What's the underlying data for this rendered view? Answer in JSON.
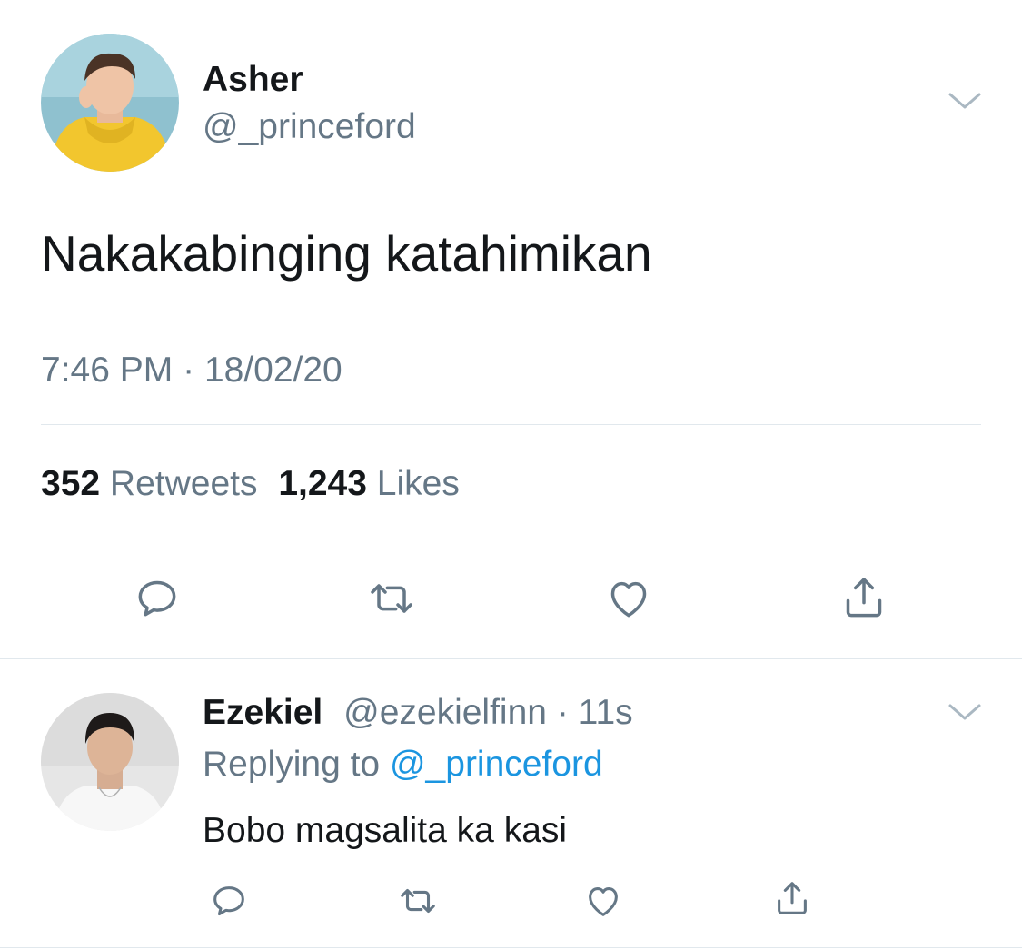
{
  "main_tweet": {
    "author_name": "Asher",
    "author_handle": "@_princeford",
    "text": "Nakakabinging katahimikan",
    "time": "7:46 PM",
    "separator": "·",
    "date": "18/02/20",
    "retweets_count": "352",
    "retweets_label": "Retweets",
    "likes_count": "1,243",
    "likes_label": "Likes",
    "actions": [
      "reply-icon",
      "retweet-icon",
      "like-icon",
      "share-icon"
    ]
  },
  "reply": {
    "author_name": "Ezekiel",
    "author_handle": "@ezekielfinn",
    "separator": "·",
    "age": "11s",
    "replying_label": "Replying to",
    "replying_handle": "@_princeford",
    "text": "Bobo magsalita ka kasi",
    "actions": [
      "reply-icon",
      "retweet-icon",
      "like-icon",
      "share-icon"
    ]
  },
  "colors": {
    "text": "#14171a",
    "muted": "#657786",
    "link": "#1b95e0",
    "divider": "#e1e8ed"
  }
}
